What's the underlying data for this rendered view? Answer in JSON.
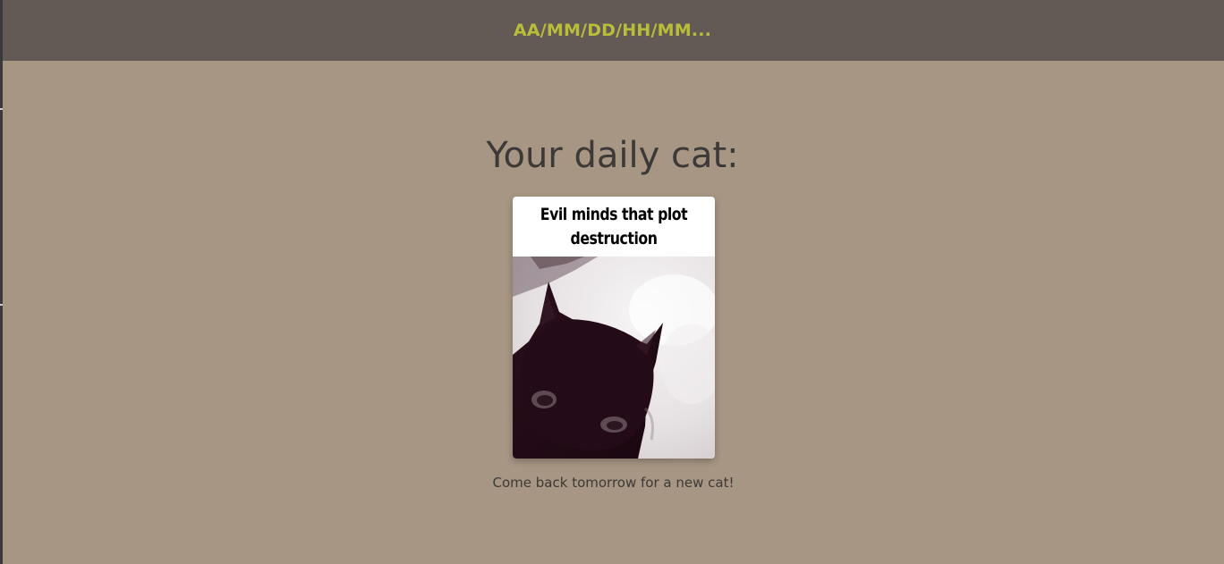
{
  "header": {
    "timestamp": "AA/MM/DD/HH/MM..."
  },
  "main": {
    "heading": "Your daily cat:",
    "card": {
      "caption": "Evil minds that plot destruction",
      "image": "black-cat-gif"
    },
    "footer": "Come back tomorrow for a new cat!"
  },
  "colors": {
    "background": "#a69683",
    "topbar": "#635a55",
    "timestamp": "#b9be3a",
    "text": "#3d3936"
  }
}
